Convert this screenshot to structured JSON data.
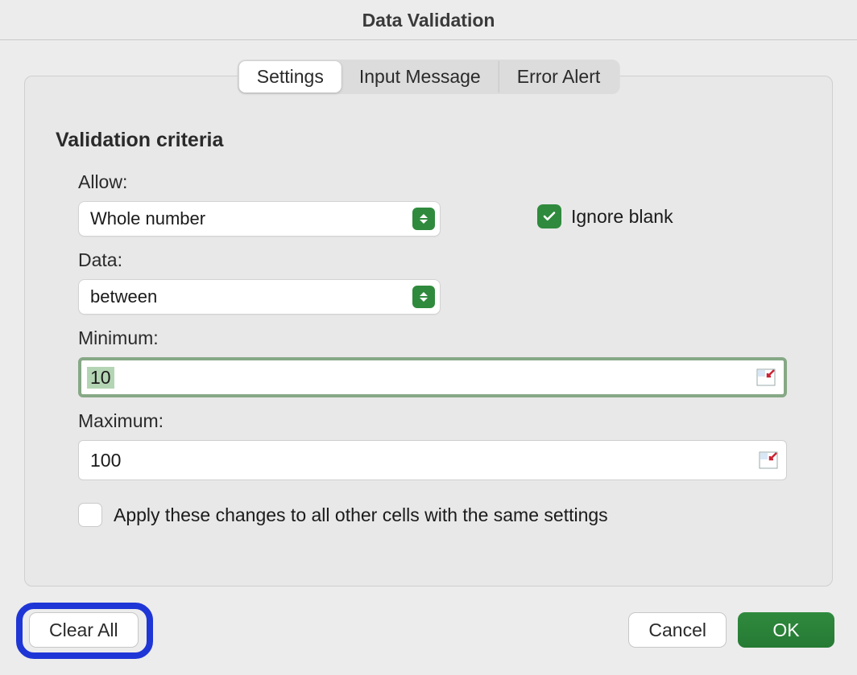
{
  "dialog": {
    "title": "Data Validation"
  },
  "tabs": {
    "settings": "Settings",
    "input_message": "Input Message",
    "error_alert": "Error Alert"
  },
  "section": {
    "title": "Validation criteria"
  },
  "allow": {
    "label": "Allow:",
    "value": "Whole number"
  },
  "ignore_blank": {
    "label": "Ignore blank",
    "checked": true
  },
  "data": {
    "label": "Data:",
    "value": "between"
  },
  "minimum": {
    "label": "Minimum:",
    "value": "10"
  },
  "maximum": {
    "label": "Maximum:",
    "value": "100"
  },
  "apply_all": {
    "label": "Apply these changes to all other cells with the same settings",
    "checked": false
  },
  "buttons": {
    "clear_all": "Clear All",
    "cancel": "Cancel",
    "ok": "OK"
  },
  "colors": {
    "accent_green": "#2f8a3d",
    "highlight_blue": "#1f36d6"
  }
}
